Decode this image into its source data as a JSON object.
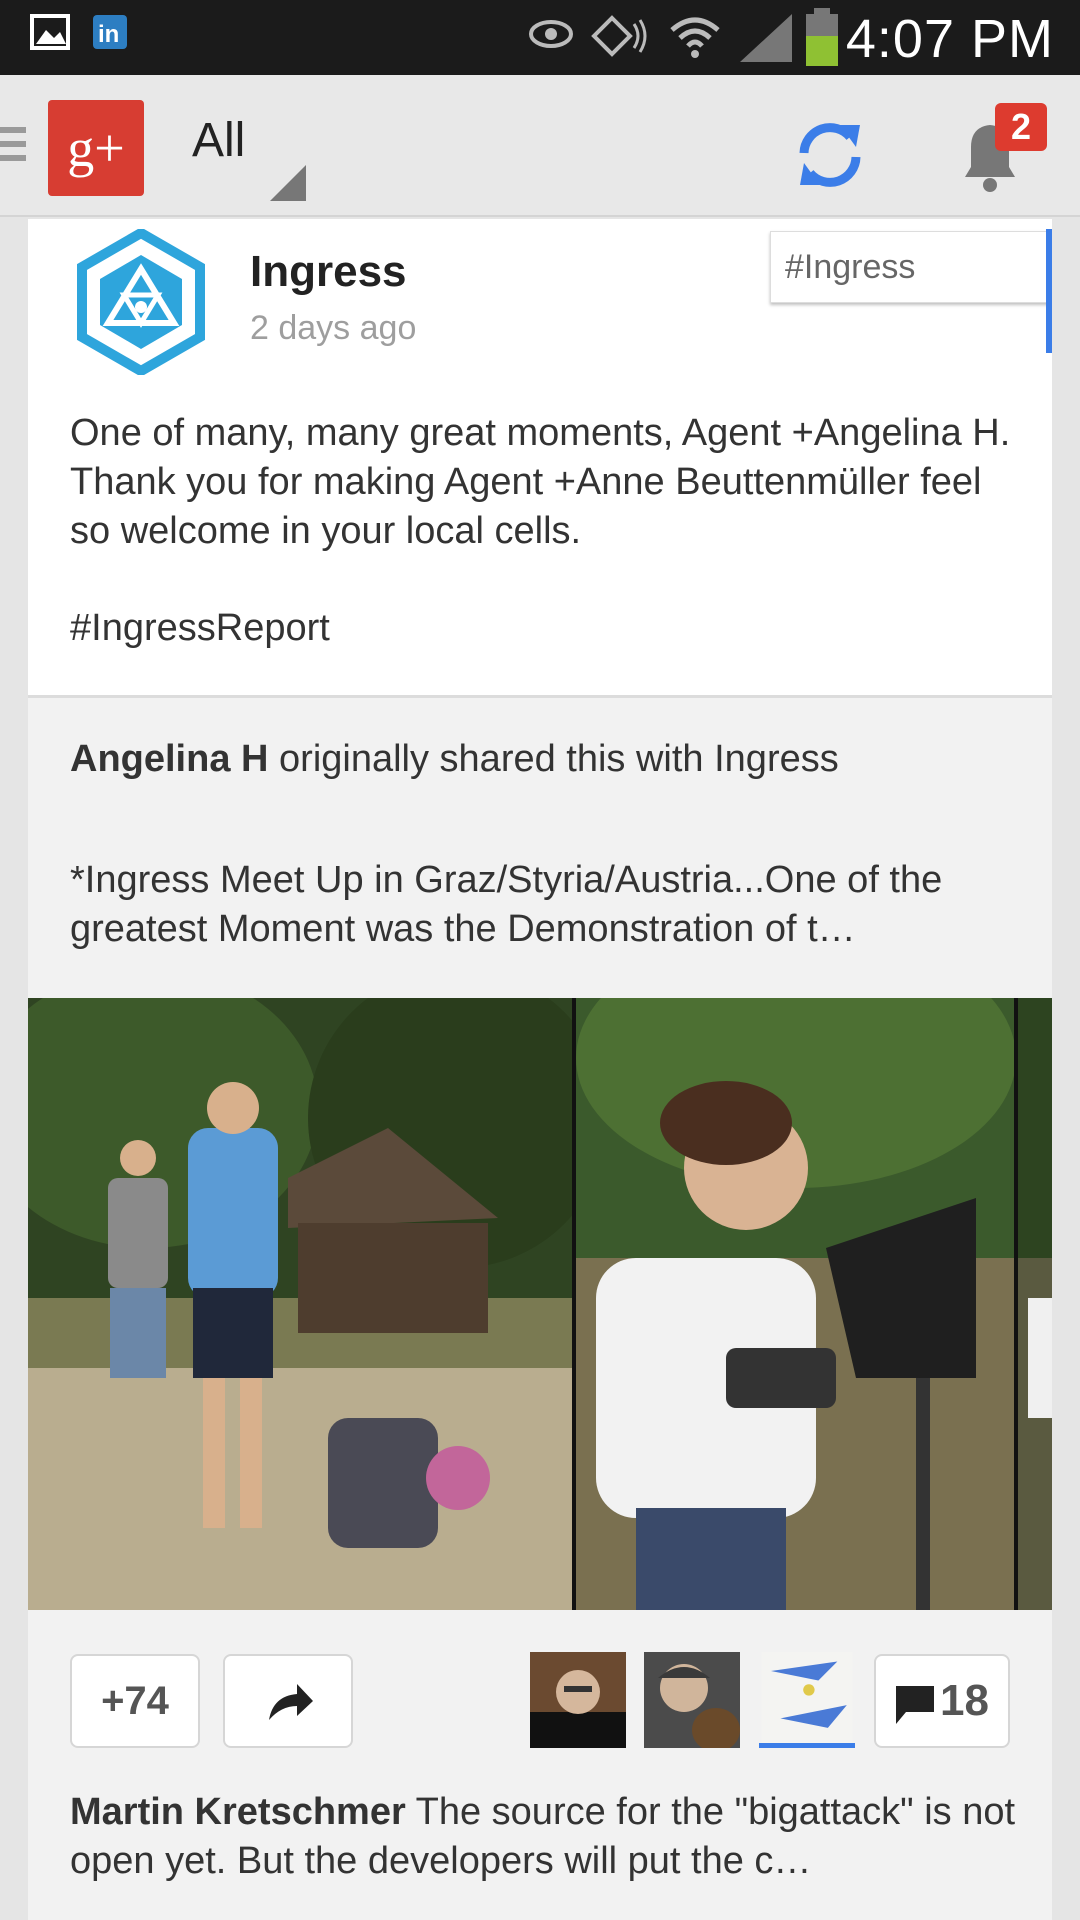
{
  "status_bar": {
    "time": "4:07 PM",
    "icons": [
      "gallery-icon",
      "linkedin-icon",
      "eye-icon",
      "nfc-icon",
      "wifi-icon",
      "signal-icon",
      "battery-icon"
    ]
  },
  "action_bar": {
    "app_logo": "g+",
    "stream_filter": "All",
    "notification_count": "2"
  },
  "post": {
    "author": "Ingress",
    "time": "2 days ago",
    "hashtag": "#Ingress",
    "body": "One of many, many great moments, Agent +Angelina H. Thank you for making Agent +Anne Beuttenmüller feel so welcome in your local cells.",
    "tag": "#IngressReport",
    "reshare": {
      "author": "Angelina H",
      "shared_text": "originally shared this with Ingress",
      "text": "*Ingress Meet Up in Graz/Styria/Austria...One of the greatest Moment was the Demonstration of t…"
    },
    "plus_count": "+74",
    "comment_count": "18",
    "top_comment": {
      "author": "Martin Kretschmer",
      "text": "The source for the \"bigattack\" is not open yet. But the developers will put the c…"
    }
  },
  "colors": {
    "brand_red": "#d73d32",
    "accent_blue": "#3b7de8",
    "ingress_cyan": "#2ea5dc"
  }
}
